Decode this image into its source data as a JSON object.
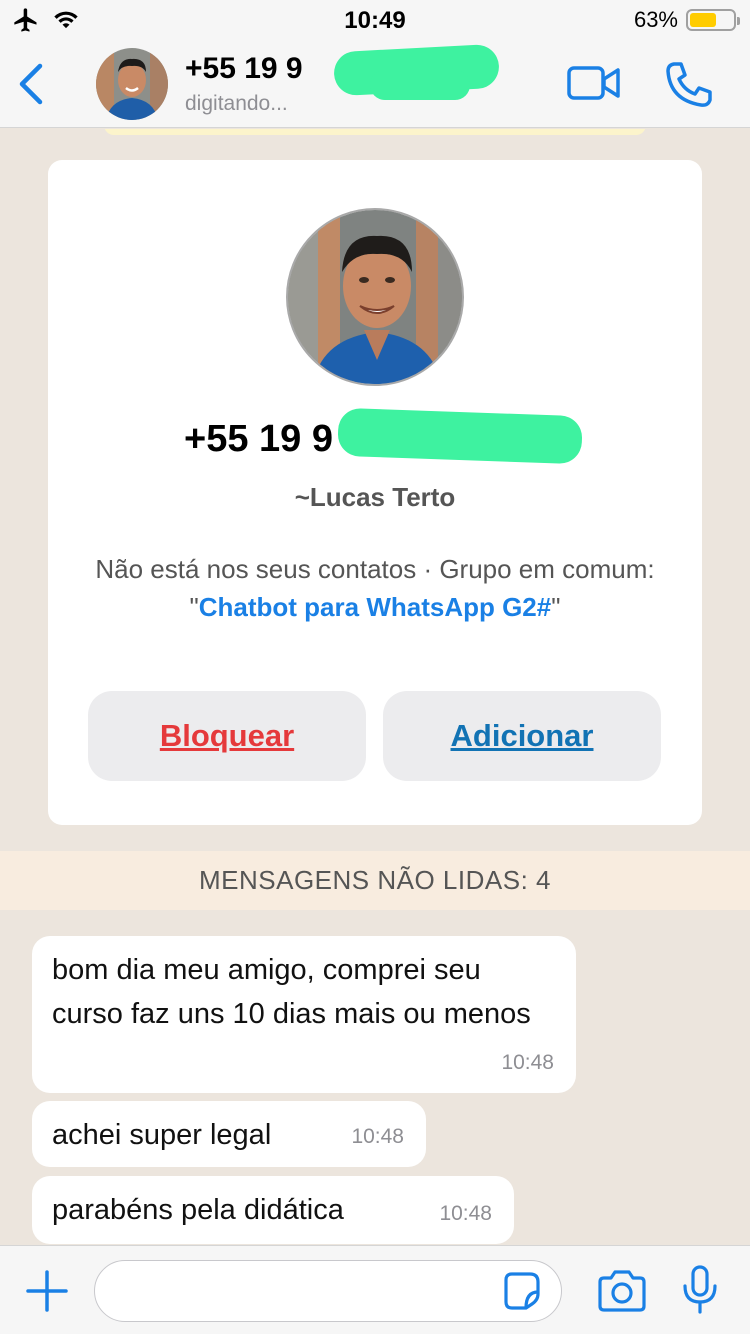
{
  "status_bar": {
    "time": "10:49",
    "battery": "63%",
    "battery_fraction": 0.63,
    "icons": [
      "airplane-icon",
      "wifi-icon",
      "battery-icon"
    ]
  },
  "header": {
    "title": "+55 19 9",
    "subtitle": "digitando...",
    "icons": [
      "chevron-left-icon",
      "video-camera-icon",
      "phone-icon"
    ]
  },
  "contact_card": {
    "phone": "+55 19 9",
    "name": "~Lucas Terto",
    "info_prefix": "Não está nos seus contatos · Grupo em comum: \"",
    "group_name": "Chatbot para WhatsApp G2#",
    "info_suffix": "\"",
    "block_label": "Bloquear",
    "add_label": "Adicionar"
  },
  "unread_banner": "MENSAGENS NÃO LIDAS: 4",
  "messages": [
    {
      "text": "bom dia meu amigo, comprei seu curso faz uns 10 dias mais ou menos",
      "time": "10:48"
    },
    {
      "text": "achei super legal",
      "time": "10:48"
    },
    {
      "text": "parabéns pela didática",
      "time": "10:48"
    }
  ],
  "input_bar": {
    "placeholder": "",
    "icons": [
      "plus-icon",
      "sticker-icon",
      "camera-icon",
      "microphone-icon"
    ]
  },
  "colors": {
    "accent_blue": "#1a80e5",
    "block_red": "#e5393b",
    "chat_background": "#ece5dd",
    "unread_banner_bg": "#f8ecdf",
    "redaction_green": "#3ef2a0"
  }
}
